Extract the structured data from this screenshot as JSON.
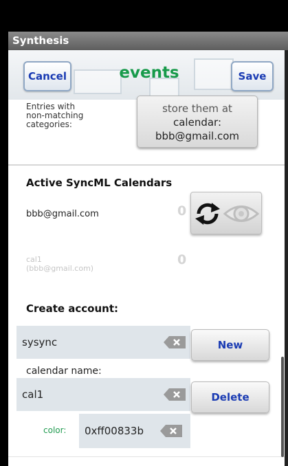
{
  "app": {
    "title": "Synthesis"
  },
  "header": {
    "cancel_label": "Cancel",
    "title": "events",
    "save_label": "Save"
  },
  "nonmatching": {
    "label_lines": [
      "Entries with",
      "non-matching",
      "categories:"
    ],
    "store_button_lines": [
      "store them at",
      "calendar:",
      "bbb@gmail.com"
    ]
  },
  "active_calendars": {
    "title": "Active SyncML Calendars",
    "items": [
      {
        "name": "bbb@gmail.com",
        "count": "0",
        "enabled": true
      },
      {
        "name_lines": [
          "cal1",
          "(bbb@gmail.com)"
        ],
        "count": "0",
        "enabled": false
      }
    ],
    "icons": [
      "sync-icon",
      "eye-icon"
    ]
  },
  "create_account": {
    "title": "Create account:",
    "account_value": "sysync",
    "new_label": "New",
    "calendar_name_label": "calendar name:",
    "calendar_name_value": "cal1",
    "delete_label": "Delete",
    "color_label": "color:",
    "color_value": "0xff00833b"
  },
  "colors": {
    "title_green": "#179a4a",
    "button_blue": "#1a3bb3",
    "color_label_green": "#1e9a4e",
    "field_bg": "#dfe5ea"
  }
}
